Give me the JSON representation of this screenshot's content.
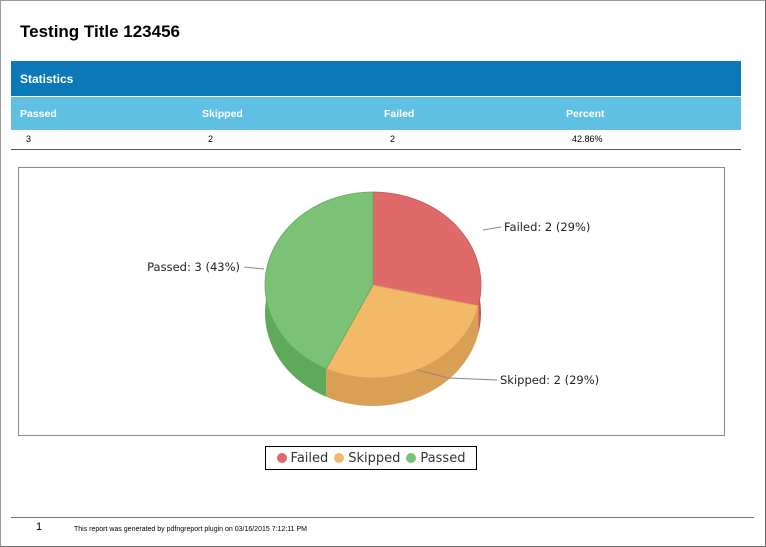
{
  "title": "Testing Title 123456",
  "statistics": {
    "header": "Statistics",
    "columns": [
      "Passed",
      "Skipped",
      "Failed",
      "Percent"
    ],
    "row": [
      "3",
      "2",
      "2",
      "42.86%"
    ]
  },
  "chart_data": {
    "type": "pie",
    "categories": [
      "Failed",
      "Skipped",
      "Passed"
    ],
    "values": [
      2,
      2,
      3
    ],
    "percents": [
      29,
      29,
      43
    ],
    "slice_labels": [
      "Failed: 2 (29%)",
      "Skipped: 2 (29%)",
      "Passed: 3 (43%)"
    ],
    "colors": [
      "#e06a6a",
      "#f2b969",
      "#7cc276"
    ],
    "dark_colors": [
      "#c65555",
      "#d99f55",
      "#5fa95b"
    ],
    "legend": [
      "Failed",
      "Skipped",
      "Passed"
    ],
    "legend_position": "bottom"
  },
  "footer": {
    "page_number": "1",
    "text": "This report was generated by pdfngreport plugin  on 03/16/2015 7:12:11 PM"
  }
}
